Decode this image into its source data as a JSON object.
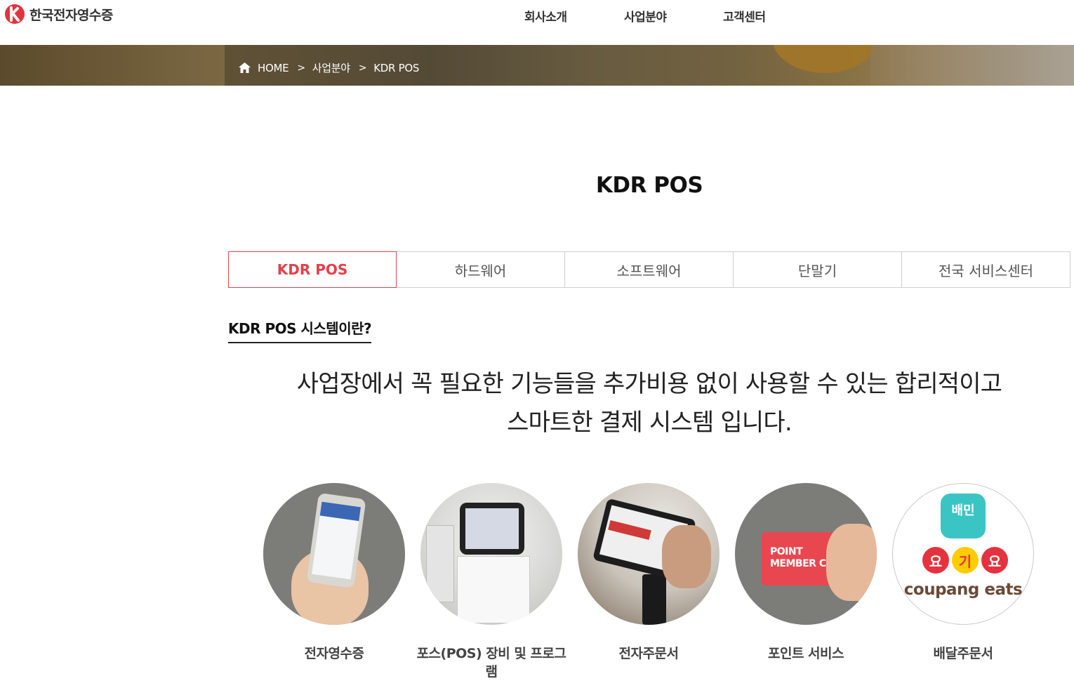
{
  "header": {
    "logo_text": "한국전자영수증",
    "nav": [
      "회사소개",
      "사업분야",
      "고객센터"
    ]
  },
  "breadcrumb": {
    "items": [
      "HOME",
      "사업분야",
      "KDR POS"
    ],
    "separator": ">"
  },
  "page": {
    "title": "KDR POS"
  },
  "tabs": [
    {
      "label": "KDR POS",
      "active": true
    },
    {
      "label": "하드웨어",
      "active": false
    },
    {
      "label": "소프트웨어",
      "active": false
    },
    {
      "label": "단말기",
      "active": false
    },
    {
      "label": "전국 서비스센터",
      "active": false
    }
  ],
  "section": {
    "heading": "KDR POS 시스템이란?",
    "intro_line1": "사업장에서 꼭 필요한 기능들을 추가비용 없이 사용할 수 있는 합리적이고",
    "intro_line2": "스마트한 결제 시스템 입니다."
  },
  "services": [
    {
      "label": "전자영수증"
    },
    {
      "label": "포스(POS) 장비 및 프로그램"
    },
    {
      "label": "전자주문서"
    },
    {
      "label": "포인트 서비스",
      "image_text": "POINT\nMEMBER CARD"
    },
    {
      "label": "배달주문서",
      "image_texts": [
        "배민",
        "요",
        "기",
        "요",
        "coupang eats"
      ]
    }
  ],
  "colors": {
    "accent": "#e5404a",
    "text": "#222222",
    "tab_border": "#cfcfcf"
  }
}
